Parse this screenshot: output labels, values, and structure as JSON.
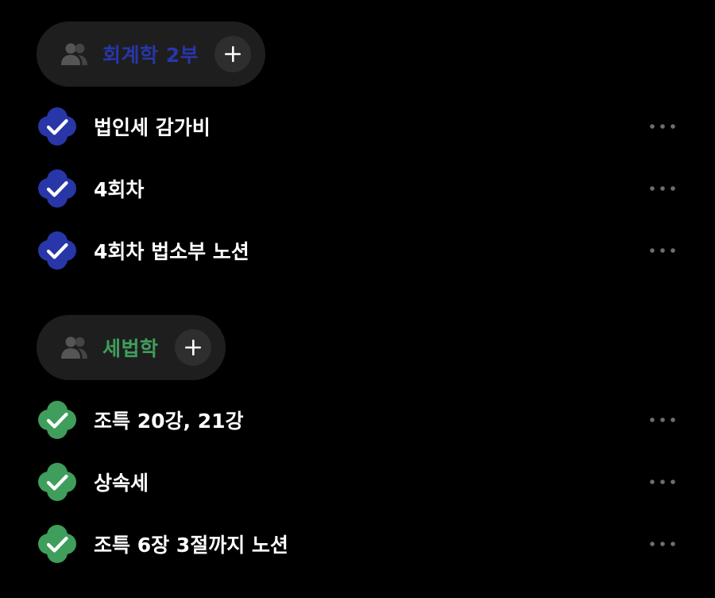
{
  "groups": [
    {
      "name": "회계학 2부",
      "color": "#2836a8",
      "tasks": [
        {
          "title": "법인세 감가비",
          "done": true
        },
        {
          "title": "4회차",
          "done": true
        },
        {
          "title": "4회차 법소부 노션",
          "done": true
        }
      ]
    },
    {
      "name": "세법학",
      "color": "#3f9e5c",
      "tasks": [
        {
          "title": "조특 20강, 21강",
          "done": true
        },
        {
          "title": "상속세",
          "done": true
        },
        {
          "title": "조특 6장 3절까지 노션",
          "done": true
        }
      ]
    }
  ],
  "icons": {
    "group": "people-icon",
    "add": "plus-icon",
    "check": "checkmark-icon",
    "more": "more-horizontal-icon"
  },
  "colors": {
    "background": "#000000",
    "pill": "#1e1e1e",
    "add_button": "#2e2e2e",
    "more_dots": "#6e6e6e"
  }
}
